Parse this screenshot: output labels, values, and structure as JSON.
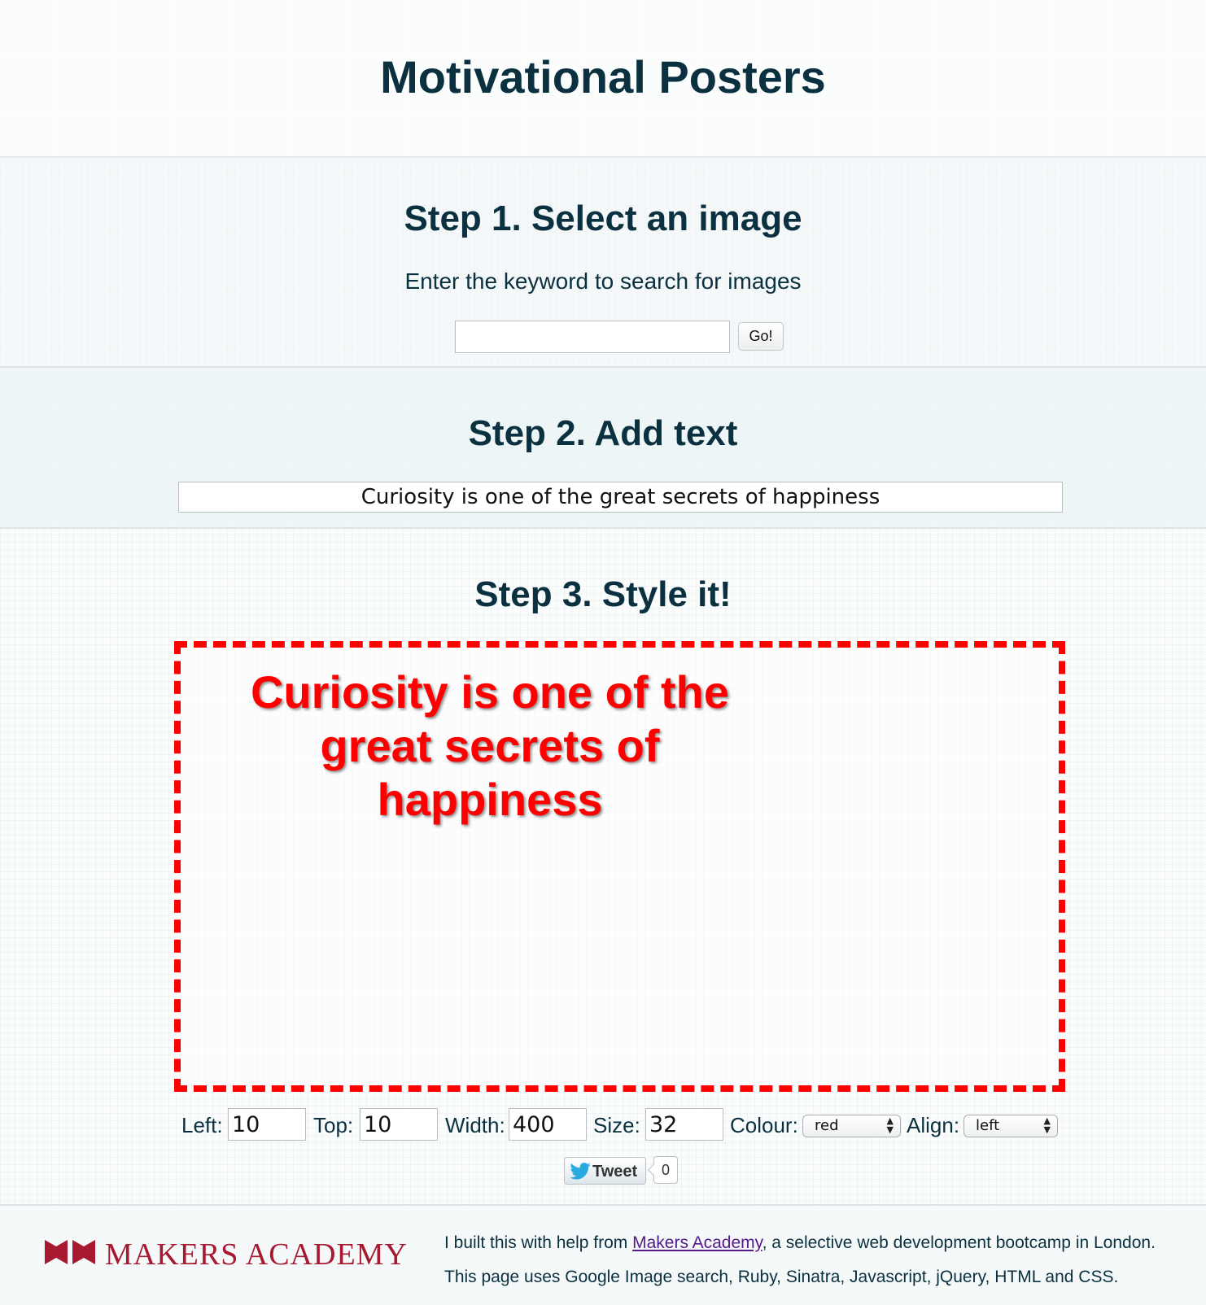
{
  "header": {
    "title": "Motivational Posters"
  },
  "step1": {
    "heading": "Step 1. Select an image",
    "instruction": "Enter the keyword to search for images",
    "search_value": "",
    "go_label": "Go!"
  },
  "step2": {
    "heading": "Step 2. Add text",
    "text_value": "Curiosity is one of the great secrets of happiness"
  },
  "step3": {
    "heading": "Step 3. Style it!",
    "poster_text": "Curiosity is one of the great secrets of happiness",
    "poster_text_color": "#ff0000",
    "poster_border_color": "#ff0000",
    "controls": {
      "left_label": "Left:",
      "left_value": "10",
      "top_label": "Top:",
      "top_value": "10",
      "width_label": "Width:",
      "width_value": "400",
      "size_label": "Size:",
      "size_value": "32",
      "colour_label": "Colour:",
      "colour_value": "red",
      "align_label": "Align:",
      "align_value": "left"
    },
    "tweet": {
      "label": "Tweet",
      "count": "0",
      "icon": "twitter-bird-icon"
    }
  },
  "footer": {
    "logo_text": "MAKERS ACADEMY",
    "logo_color": "#a6192e",
    "credit_prefix": "I built this with help from ",
    "credit_link": "Makers Academy",
    "credit_suffix": ", a selective web development bootcamp in London.",
    "tech_line": "This page uses Google Image search, Ruby, Sinatra, Javascript, jQuery, HTML and CSS."
  }
}
